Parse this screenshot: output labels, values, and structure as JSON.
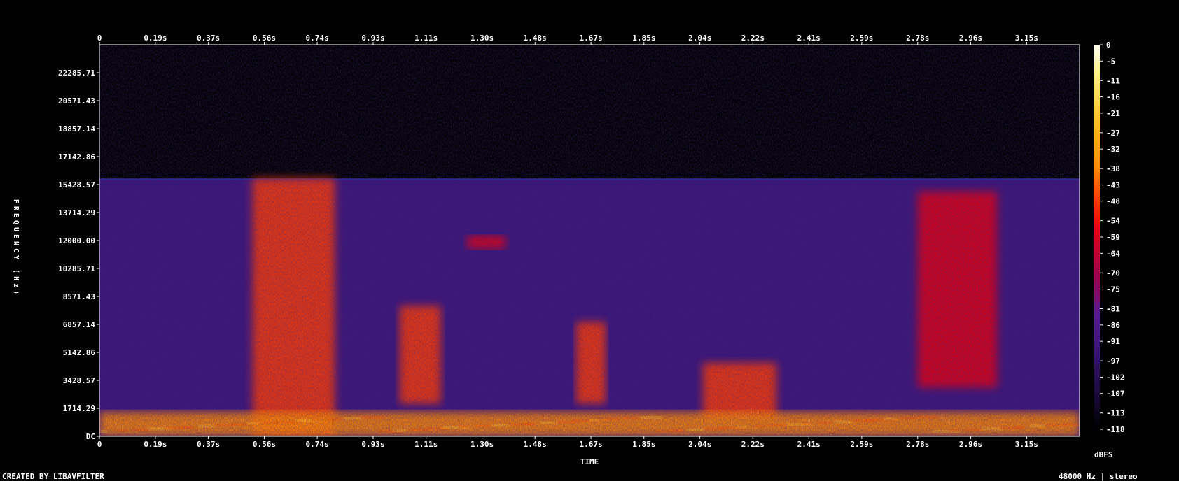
{
  "chart_data": {
    "type": "heatmap",
    "title": "",
    "xlabel": "TIME",
    "ylabel": "FREQUENCY (Hz)",
    "x_ticks": [
      "0",
      "0.19s",
      "0.37s",
      "0.56s",
      "0.74s",
      "0.93s",
      "1.11s",
      "1.30s",
      "1.48s",
      "1.67s",
      "1.85s",
      "2.04s",
      "2.22s",
      "2.41s",
      "2.59s",
      "2.78s",
      "2.96s",
      "3.15s"
    ],
    "x_tick_values": [
      0,
      0.19,
      0.37,
      0.56,
      0.74,
      0.93,
      1.11,
      1.3,
      1.48,
      1.67,
      1.85,
      2.04,
      2.22,
      2.41,
      2.59,
      2.78,
      2.96,
      3.15
    ],
    "xlim": [
      0,
      3.33
    ],
    "y_ticks": [
      "DC",
      "1714.29",
      "3428.57",
      "5142.86",
      "6857.14",
      "8571.43",
      "10285.71",
      "12000.00",
      "13714.29",
      "15428.57",
      "17142.86",
      "18857.14",
      "20571.43",
      "22285.71"
    ],
    "y_tick_values": [
      0,
      1714.29,
      3428.57,
      5142.86,
      6857.14,
      8571.43,
      10285.71,
      12000.0,
      13714.29,
      15428.57,
      17142.86,
      18857.14,
      20571.43,
      22285.71
    ],
    "ylim": [
      0,
      24000
    ],
    "colorbar": {
      "label": "dBFS",
      "range": [
        -118,
        0
      ],
      "ticks": [
        "0",
        "-5",
        "-11",
        "-16",
        "-21",
        "-27",
        "-32",
        "-38",
        "-43",
        "-48",
        "-54",
        "-59",
        "-64",
        "-70",
        "-75",
        "-81",
        "-86",
        "-91",
        "-97",
        "-102",
        "-107",
        "-113",
        "-118"
      ],
      "tick_values": [
        0,
        -5,
        -11,
        -16,
        -21,
        -27,
        -32,
        -38,
        -43,
        -48,
        -54,
        -59,
        -64,
        -70,
        -75,
        -81,
        -86,
        -91,
        -97,
        -102,
        -107,
        -113,
        -118
      ],
      "colors": [
        "#fffff0",
        "#ffee80",
        "#ffc020",
        "#ff8a00",
        "#ff3b00",
        "#e60010",
        "#a00050",
        "#5a1a8c",
        "#3a1470",
        "#1c0a44",
        "#000000"
      ]
    },
    "cutoff_frequency": 15800,
    "energy_regions": [
      {
        "t_start": 0.52,
        "t_end": 0.8,
        "f_low": 0,
        "f_high": 15800,
        "level_db": -48
      },
      {
        "t_start": 1.02,
        "t_end": 1.16,
        "f_low": 2000,
        "f_high": 8000,
        "level_db": -50
      },
      {
        "t_start": 1.25,
        "t_end": 1.38,
        "f_low": 11500,
        "f_high": 12300,
        "level_db": -60
      },
      {
        "t_start": 1.62,
        "t_end": 1.72,
        "f_low": 2000,
        "f_high": 7000,
        "level_db": -55
      },
      {
        "t_start": 2.05,
        "t_end": 2.3,
        "f_low": 1000,
        "f_high": 4500,
        "level_db": -55
      },
      {
        "t_start": 2.78,
        "t_end": 3.05,
        "f_low": 3000,
        "f_high": 15000,
        "level_db": -70
      },
      {
        "t_start": 0.0,
        "t_end": 3.33,
        "f_low": 0,
        "f_high": 1500,
        "level_db": -45
      }
    ]
  },
  "footer": {
    "left": "CREATED BY LIBAVFILTER",
    "right": "48000 Hz | stereo"
  }
}
